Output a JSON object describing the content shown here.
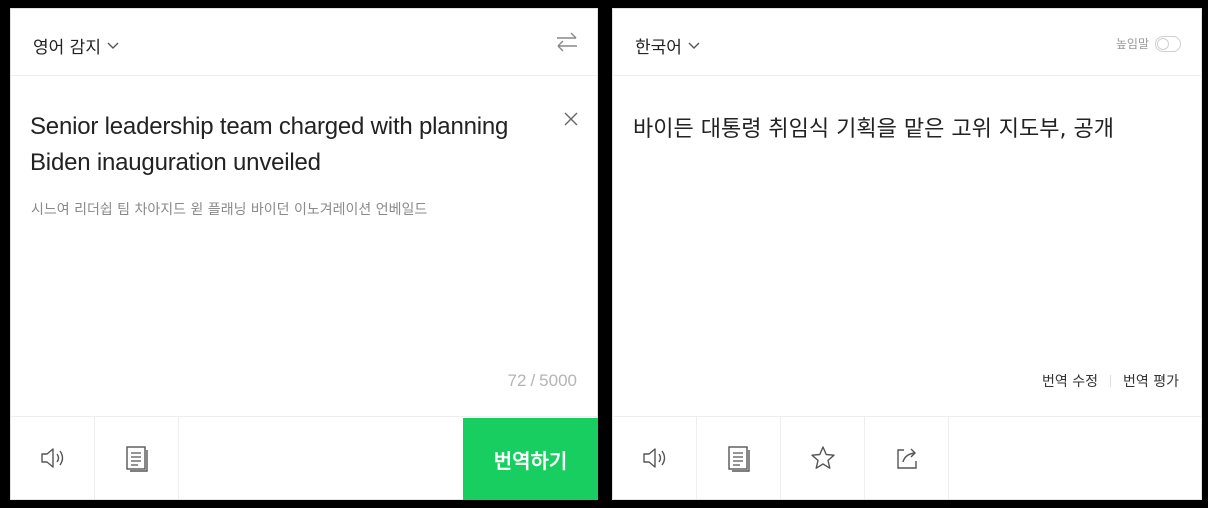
{
  "source": {
    "language": "영어 감지",
    "text": "Senior leadership team charged with planning Biden inauguration unveiled",
    "pronunciation": "시느여 리더쉽 팀 차아지드 윋 플래닝 바이던 이노겨레이션 언베일드",
    "char_count": "72",
    "char_limit": "5000",
    "char_separator": "/",
    "translate_button": "번역하기"
  },
  "target": {
    "language": "한국어",
    "honorific_label": "높임말",
    "honorific_on": false,
    "text": "바이든 대통령 취임식 기획을 맡은 고위 지도부, 공개",
    "edit_label": "번역 수정",
    "rate_label": "번역 평가"
  },
  "icons": {
    "speaker": "speaker-icon",
    "dictionary": "document-icon",
    "favorite": "star-icon",
    "share": "share-icon",
    "swap": "swap-icon",
    "clear": "close-icon"
  },
  "colors": {
    "accent": "#19ce60",
    "background": "#000000",
    "panel": "#ffffff"
  }
}
